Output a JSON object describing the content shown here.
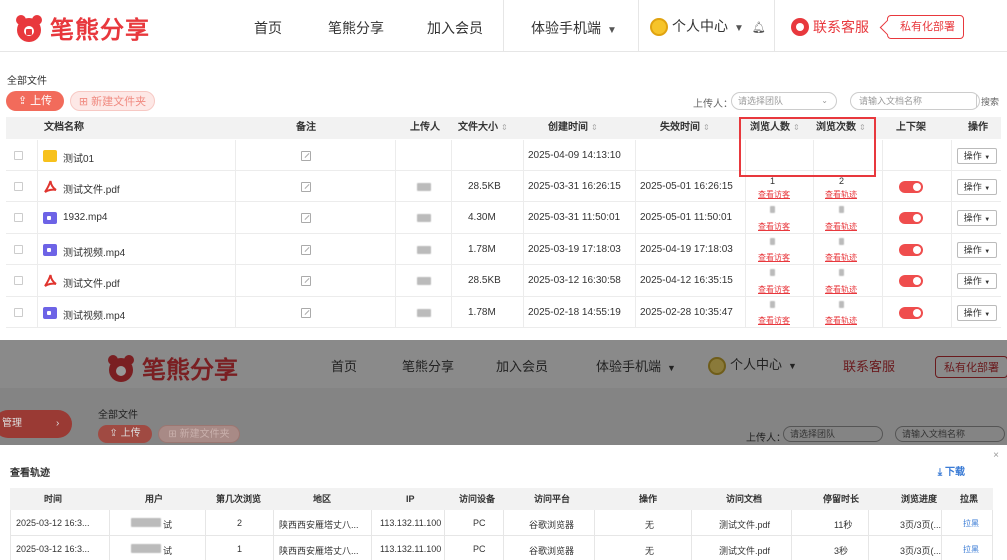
{
  "header": {
    "logo_text": "笔熊分享",
    "nav": [
      "首页",
      "笔熊分享",
      "加入会员",
      "体验手机端"
    ],
    "user_center": "个人中心",
    "service": "联系客服",
    "private_deploy": "私有化部署"
  },
  "breadcrumb": "全部文件",
  "toolbar": {
    "upload": "上传",
    "new_folder": "新建文件夹",
    "uploader_label": "上传人：",
    "team_placeholder": "请选择团队",
    "name_placeholder": "请输入文档名称",
    "search": "搜索"
  },
  "table": {
    "headers": [
      "文档名称",
      "备注",
      "上传人",
      "文件大小",
      "创建时间",
      "失效时间",
      "浏览人数",
      "浏览次数",
      "上下架",
      "操作"
    ],
    "view_visitors_link": "查看访客",
    "view_track_link": "查看轨迹",
    "op_label": "操作",
    "rows": [
      {
        "name": "测试01",
        "type": "folder",
        "size": "",
        "created": "2025-04-09 14:13:10",
        "expires": "",
        "viewers": "",
        "views": "",
        "toggle": false
      },
      {
        "name": "测试文件.pdf",
        "type": "pdf",
        "size": "28.5KB",
        "created": "2025-03-31 16:26:15",
        "expires": "2025-05-01 16:26:15",
        "viewers": "1",
        "views": "2",
        "toggle": true
      },
      {
        "name": "1932.mp4",
        "type": "video",
        "size": "4.30M",
        "created": "2025-03-31 11:50:01",
        "expires": "2025-05-01 11:50:01",
        "viewers": "",
        "views": "",
        "toggle": true
      },
      {
        "name": "测试视频.mp4",
        "type": "video",
        "size": "1.78M",
        "created": "2025-03-19 17:18:03",
        "expires": "2025-04-19 17:18:03",
        "viewers": "",
        "views": "",
        "toggle": true
      },
      {
        "name": "测试文件.pdf",
        "type": "pdf",
        "size": "28.5KB",
        "created": "2025-03-12 16:30:58",
        "expires": "2025-04-12 16:35:15",
        "viewers": "",
        "views": "",
        "toggle": true
      },
      {
        "name": "测试视频.mp4",
        "type": "video",
        "size": "1.78M",
        "created": "2025-02-18 14:55:19",
        "expires": "2025-02-28 10:35:47",
        "viewers": "",
        "views": "",
        "toggle": true
      }
    ]
  },
  "overlay": {
    "logo_text": "笔熊分享",
    "nav": [
      "首页",
      "笔熊分享",
      "加入会员",
      "体验手机端"
    ],
    "user_center": "个人中心",
    "service": "联系客服",
    "private_deploy": "私有化部署",
    "side_pill": "管理",
    "breadcrumb": "全部文件",
    "upload": "上传",
    "new_folder": "新建文件夹",
    "uploader_label": "上传人：",
    "team_placeholder": "请选择团队",
    "name_placeholder": "请输入文档名称"
  },
  "drawer": {
    "title": "查看轨迹",
    "download": "下载",
    "close": "×",
    "headers": [
      "时间",
      "用户",
      "第几次浏览",
      "地区",
      "IP",
      "访问设备",
      "访问平台",
      "操作",
      "访问文档",
      "停留时长",
      "浏览进度",
      "拉黑"
    ],
    "rows": [
      {
        "time": "2025-03-12 16:3...",
        "user_suffix": "试",
        "nth": "2",
        "region": "陕西西安雁塔丈八...",
        "ip": "113.132.11.100",
        "device": "PC",
        "platform": "谷歌浏览器",
        "action": "无",
        "doc": "测试文件.pdf",
        "stay": "11秒",
        "progress": "3页/3页(...",
        "block": "拉黑"
      },
      {
        "time": "2025-03-12 16:3...",
        "user_suffix": "试",
        "nth": "1",
        "region": "陕西西安雁塔丈八...",
        "ip": "113.132.11.100",
        "device": "PC",
        "platform": "谷歌浏览器",
        "action": "无",
        "doc": "测试文件.pdf",
        "stay": "3秒",
        "progress": "3页/3页(...",
        "block": "拉黑"
      }
    ]
  },
  "colors": {
    "brand_red": "#e8383d",
    "upload_btn": "#f26b5b",
    "link_blue": "#3a7bd5",
    "toggle_on": "#ef4d4d"
  }
}
